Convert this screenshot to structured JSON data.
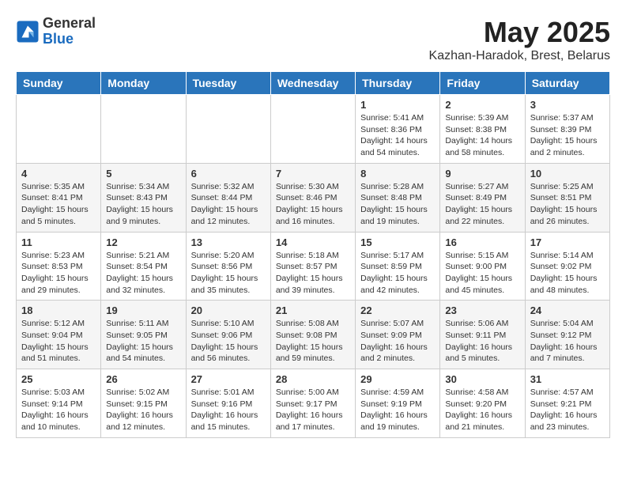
{
  "logo": {
    "general": "General",
    "blue": "Blue"
  },
  "title": {
    "month_year": "May 2025",
    "location": "Kazhan-Haradok, Brest, Belarus"
  },
  "headers": [
    "Sunday",
    "Monday",
    "Tuesday",
    "Wednesday",
    "Thursday",
    "Friday",
    "Saturday"
  ],
  "weeks": [
    [
      {
        "day": "",
        "info": ""
      },
      {
        "day": "",
        "info": ""
      },
      {
        "day": "",
        "info": ""
      },
      {
        "day": "",
        "info": ""
      },
      {
        "day": "1",
        "info": "Sunrise: 5:41 AM\nSunset: 8:36 PM\nDaylight: 14 hours\nand 54 minutes."
      },
      {
        "day": "2",
        "info": "Sunrise: 5:39 AM\nSunset: 8:38 PM\nDaylight: 14 hours\nand 58 minutes."
      },
      {
        "day": "3",
        "info": "Sunrise: 5:37 AM\nSunset: 8:39 PM\nDaylight: 15 hours\nand 2 minutes."
      }
    ],
    [
      {
        "day": "4",
        "info": "Sunrise: 5:35 AM\nSunset: 8:41 PM\nDaylight: 15 hours\nand 5 minutes."
      },
      {
        "day": "5",
        "info": "Sunrise: 5:34 AM\nSunset: 8:43 PM\nDaylight: 15 hours\nand 9 minutes."
      },
      {
        "day": "6",
        "info": "Sunrise: 5:32 AM\nSunset: 8:44 PM\nDaylight: 15 hours\nand 12 minutes."
      },
      {
        "day": "7",
        "info": "Sunrise: 5:30 AM\nSunset: 8:46 PM\nDaylight: 15 hours\nand 16 minutes."
      },
      {
        "day": "8",
        "info": "Sunrise: 5:28 AM\nSunset: 8:48 PM\nDaylight: 15 hours\nand 19 minutes."
      },
      {
        "day": "9",
        "info": "Sunrise: 5:27 AM\nSunset: 8:49 PM\nDaylight: 15 hours\nand 22 minutes."
      },
      {
        "day": "10",
        "info": "Sunrise: 5:25 AM\nSunset: 8:51 PM\nDaylight: 15 hours\nand 26 minutes."
      }
    ],
    [
      {
        "day": "11",
        "info": "Sunrise: 5:23 AM\nSunset: 8:53 PM\nDaylight: 15 hours\nand 29 minutes."
      },
      {
        "day": "12",
        "info": "Sunrise: 5:21 AM\nSunset: 8:54 PM\nDaylight: 15 hours\nand 32 minutes."
      },
      {
        "day": "13",
        "info": "Sunrise: 5:20 AM\nSunset: 8:56 PM\nDaylight: 15 hours\nand 35 minutes."
      },
      {
        "day": "14",
        "info": "Sunrise: 5:18 AM\nSunset: 8:57 PM\nDaylight: 15 hours\nand 39 minutes."
      },
      {
        "day": "15",
        "info": "Sunrise: 5:17 AM\nSunset: 8:59 PM\nDaylight: 15 hours\nand 42 minutes."
      },
      {
        "day": "16",
        "info": "Sunrise: 5:15 AM\nSunset: 9:00 PM\nDaylight: 15 hours\nand 45 minutes."
      },
      {
        "day": "17",
        "info": "Sunrise: 5:14 AM\nSunset: 9:02 PM\nDaylight: 15 hours\nand 48 minutes."
      }
    ],
    [
      {
        "day": "18",
        "info": "Sunrise: 5:12 AM\nSunset: 9:04 PM\nDaylight: 15 hours\nand 51 minutes."
      },
      {
        "day": "19",
        "info": "Sunrise: 5:11 AM\nSunset: 9:05 PM\nDaylight: 15 hours\nand 54 minutes."
      },
      {
        "day": "20",
        "info": "Sunrise: 5:10 AM\nSunset: 9:06 PM\nDaylight: 15 hours\nand 56 minutes."
      },
      {
        "day": "21",
        "info": "Sunrise: 5:08 AM\nSunset: 9:08 PM\nDaylight: 15 hours\nand 59 minutes."
      },
      {
        "day": "22",
        "info": "Sunrise: 5:07 AM\nSunset: 9:09 PM\nDaylight: 16 hours\nand 2 minutes."
      },
      {
        "day": "23",
        "info": "Sunrise: 5:06 AM\nSunset: 9:11 PM\nDaylight: 16 hours\nand 5 minutes."
      },
      {
        "day": "24",
        "info": "Sunrise: 5:04 AM\nSunset: 9:12 PM\nDaylight: 16 hours\nand 7 minutes."
      }
    ],
    [
      {
        "day": "25",
        "info": "Sunrise: 5:03 AM\nSunset: 9:14 PM\nDaylight: 16 hours\nand 10 minutes."
      },
      {
        "day": "26",
        "info": "Sunrise: 5:02 AM\nSunset: 9:15 PM\nDaylight: 16 hours\nand 12 minutes."
      },
      {
        "day": "27",
        "info": "Sunrise: 5:01 AM\nSunset: 9:16 PM\nDaylight: 16 hours\nand 15 minutes."
      },
      {
        "day": "28",
        "info": "Sunrise: 5:00 AM\nSunset: 9:17 PM\nDaylight: 16 hours\nand 17 minutes."
      },
      {
        "day": "29",
        "info": "Sunrise: 4:59 AM\nSunset: 9:19 PM\nDaylight: 16 hours\nand 19 minutes."
      },
      {
        "day": "30",
        "info": "Sunrise: 4:58 AM\nSunset: 9:20 PM\nDaylight: 16 hours\nand 21 minutes."
      },
      {
        "day": "31",
        "info": "Sunrise: 4:57 AM\nSunset: 9:21 PM\nDaylight: 16 hours\nand 23 minutes."
      }
    ]
  ]
}
